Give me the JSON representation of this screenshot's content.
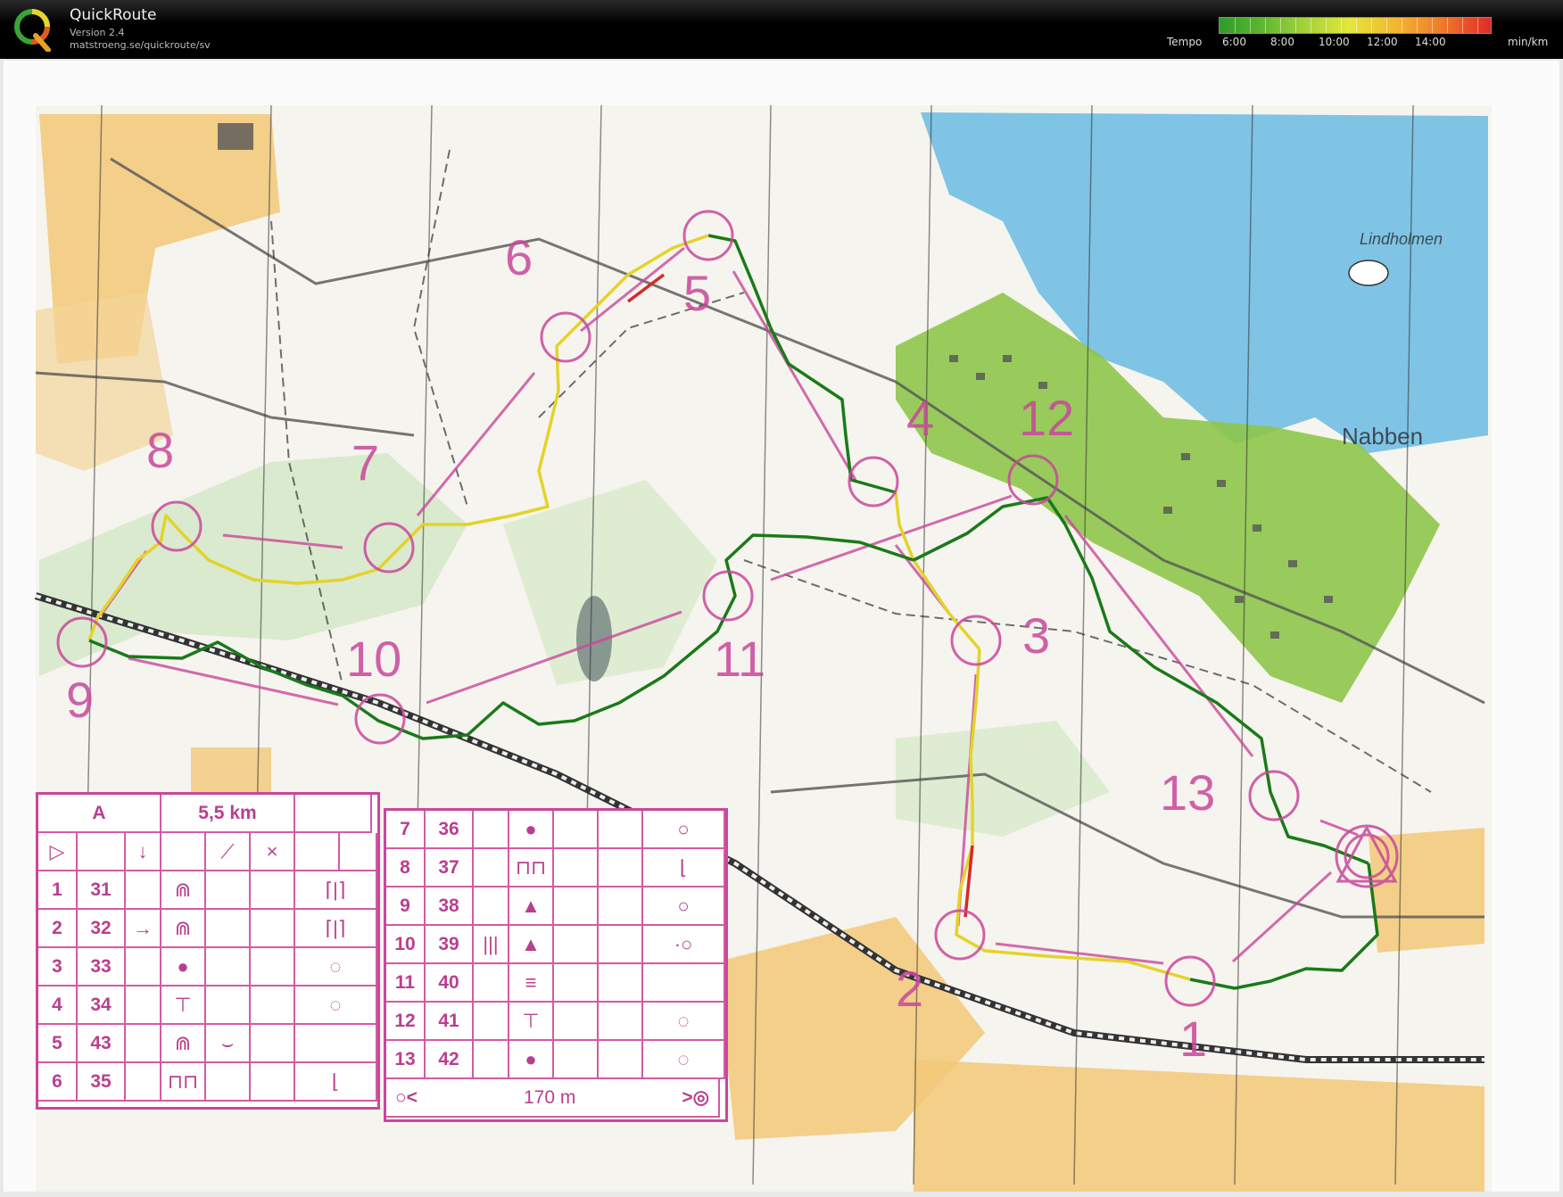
{
  "app": {
    "title": "QuickRoute",
    "version": "Version 2.4",
    "url": "matstroeng.se/quickroute/sv",
    "logo_icon": "quickroute-q-logo"
  },
  "tempo": {
    "label": "Tempo",
    "ticks": [
      "6:00",
      "8:00",
      "10:00",
      "12:00",
      "14:00"
    ],
    "unit": "min/km",
    "colors": [
      "#2e9c2a",
      "#9cd13a",
      "#e6e63a",
      "#ef7a2a",
      "#e02a2a"
    ]
  },
  "map": {
    "places": [
      "Lindholmen",
      "Nabben"
    ],
    "controls": [
      "1",
      "2",
      "3",
      "4",
      "5",
      "6",
      "7",
      "8",
      "9",
      "10",
      "11",
      "12",
      "13"
    ],
    "colors": {
      "course": "#c9479b",
      "water": "#7fc4e4",
      "open_land": "#f2c46b",
      "green": "#8ec64a",
      "route_fast": "#1a7a1a",
      "route_mid": "#e3d32a",
      "route_slow": "#d42a2a"
    }
  },
  "description_left": {
    "header": {
      "class": "A",
      "length": "5,5 km"
    },
    "symbol_row": [
      "▷",
      "",
      "↓",
      "",
      "⟋",
      "×",
      "",
      ""
    ],
    "rows": [
      {
        "num": "1",
        "code": "31",
        "dir": "",
        "feature": "⋒",
        "detail": "",
        "extra": "",
        "location": "⌈|⌉"
      },
      {
        "num": "2",
        "code": "32",
        "dir": "→",
        "feature": "⋒",
        "detail": "",
        "extra": "",
        "location": "⌈|⌉"
      },
      {
        "num": "3",
        "code": "33",
        "dir": "",
        "feature": "●",
        "detail": "",
        "extra": "",
        "location": "◌"
      },
      {
        "num": "4",
        "code": "34",
        "dir": "",
        "feature": "⊤",
        "detail": "",
        "extra": "",
        "location": "◌"
      },
      {
        "num": "5",
        "code": "43",
        "dir": "",
        "feature": "⋒",
        "detail": "⌣",
        "extra": "",
        "location": ""
      },
      {
        "num": "6",
        "code": "35",
        "dir": "",
        "feature": "⊓⊓",
        "detail": "",
        "extra": "",
        "location": "⌊"
      }
    ]
  },
  "description_right": {
    "rows": [
      {
        "num": "7",
        "code": "36",
        "dir": "",
        "feature": "●",
        "detail": "",
        "extra": "",
        "location": "○"
      },
      {
        "num": "8",
        "code": "37",
        "dir": "",
        "feature": "⊓⊓",
        "detail": "",
        "extra": "",
        "location": "⌊"
      },
      {
        "num": "9",
        "code": "38",
        "dir": "",
        "feature": "▲",
        "detail": "",
        "extra": "",
        "location": "○"
      },
      {
        "num": "10",
        "code": "39",
        "dir": "|||",
        "feature": "▲",
        "detail": "",
        "extra": "",
        "location": "·○"
      },
      {
        "num": "11",
        "code": "40",
        "dir": "",
        "feature": "≡",
        "detail": "",
        "extra": "",
        "location": ""
      },
      {
        "num": "12",
        "code": "41",
        "dir": "",
        "feature": "⊤",
        "detail": "",
        "extra": "",
        "location": "◌"
      },
      {
        "num": "13",
        "code": "42",
        "dir": "",
        "feature": "●",
        "detail": "",
        "extra": "",
        "location": "◌"
      }
    ],
    "finish": {
      "distance": "170 m"
    }
  }
}
